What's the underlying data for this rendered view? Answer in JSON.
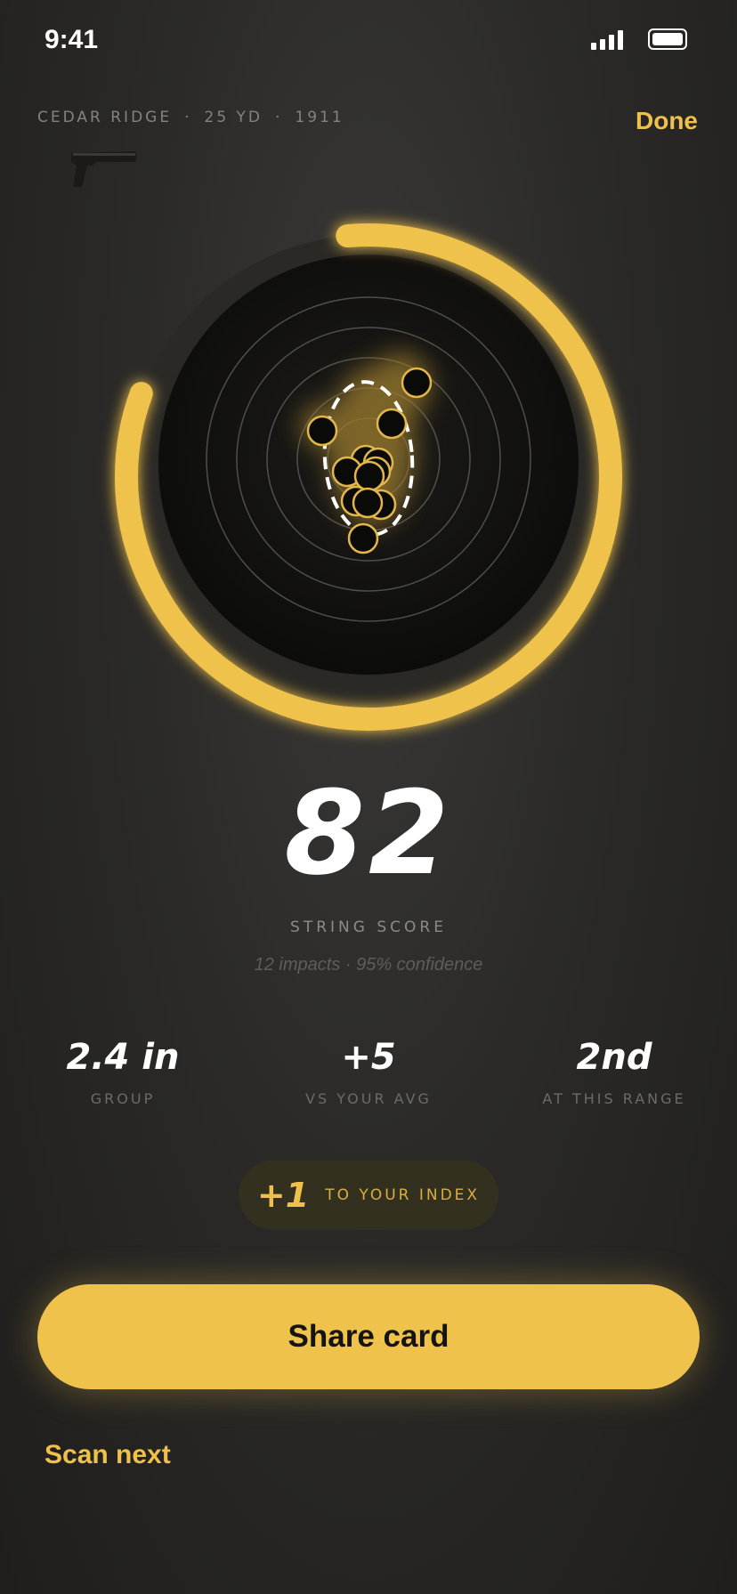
{
  "status": {
    "time": "9:41"
  },
  "header": {
    "location": "CEDAR RIDGE",
    "distance": "25 YD",
    "firearm": "1911",
    "separator": "·",
    "done_label": "Done",
    "firearm_icon": "pistol-icon"
  },
  "target": {
    "progress": 0.82,
    "accent_color": "#efc24c",
    "rings": 5,
    "impact_count": 12
  },
  "score": {
    "value": "82",
    "label": "STRING SCORE",
    "subtitle": "12 impacts · 95% confidence"
  },
  "stats": [
    {
      "value": "2.4 in",
      "label": "GROUP"
    },
    {
      "value": "+5",
      "label": "VS YOUR AVG"
    },
    {
      "value": "2nd",
      "label": "AT THIS RANGE"
    }
  ],
  "index": {
    "value": "+1",
    "label": "TO YOUR INDEX"
  },
  "actions": {
    "share_label": "Share card",
    "scan_next_label": "Scan next"
  },
  "colors": {
    "accent": "#efc24c",
    "background": "#2b2a28"
  }
}
